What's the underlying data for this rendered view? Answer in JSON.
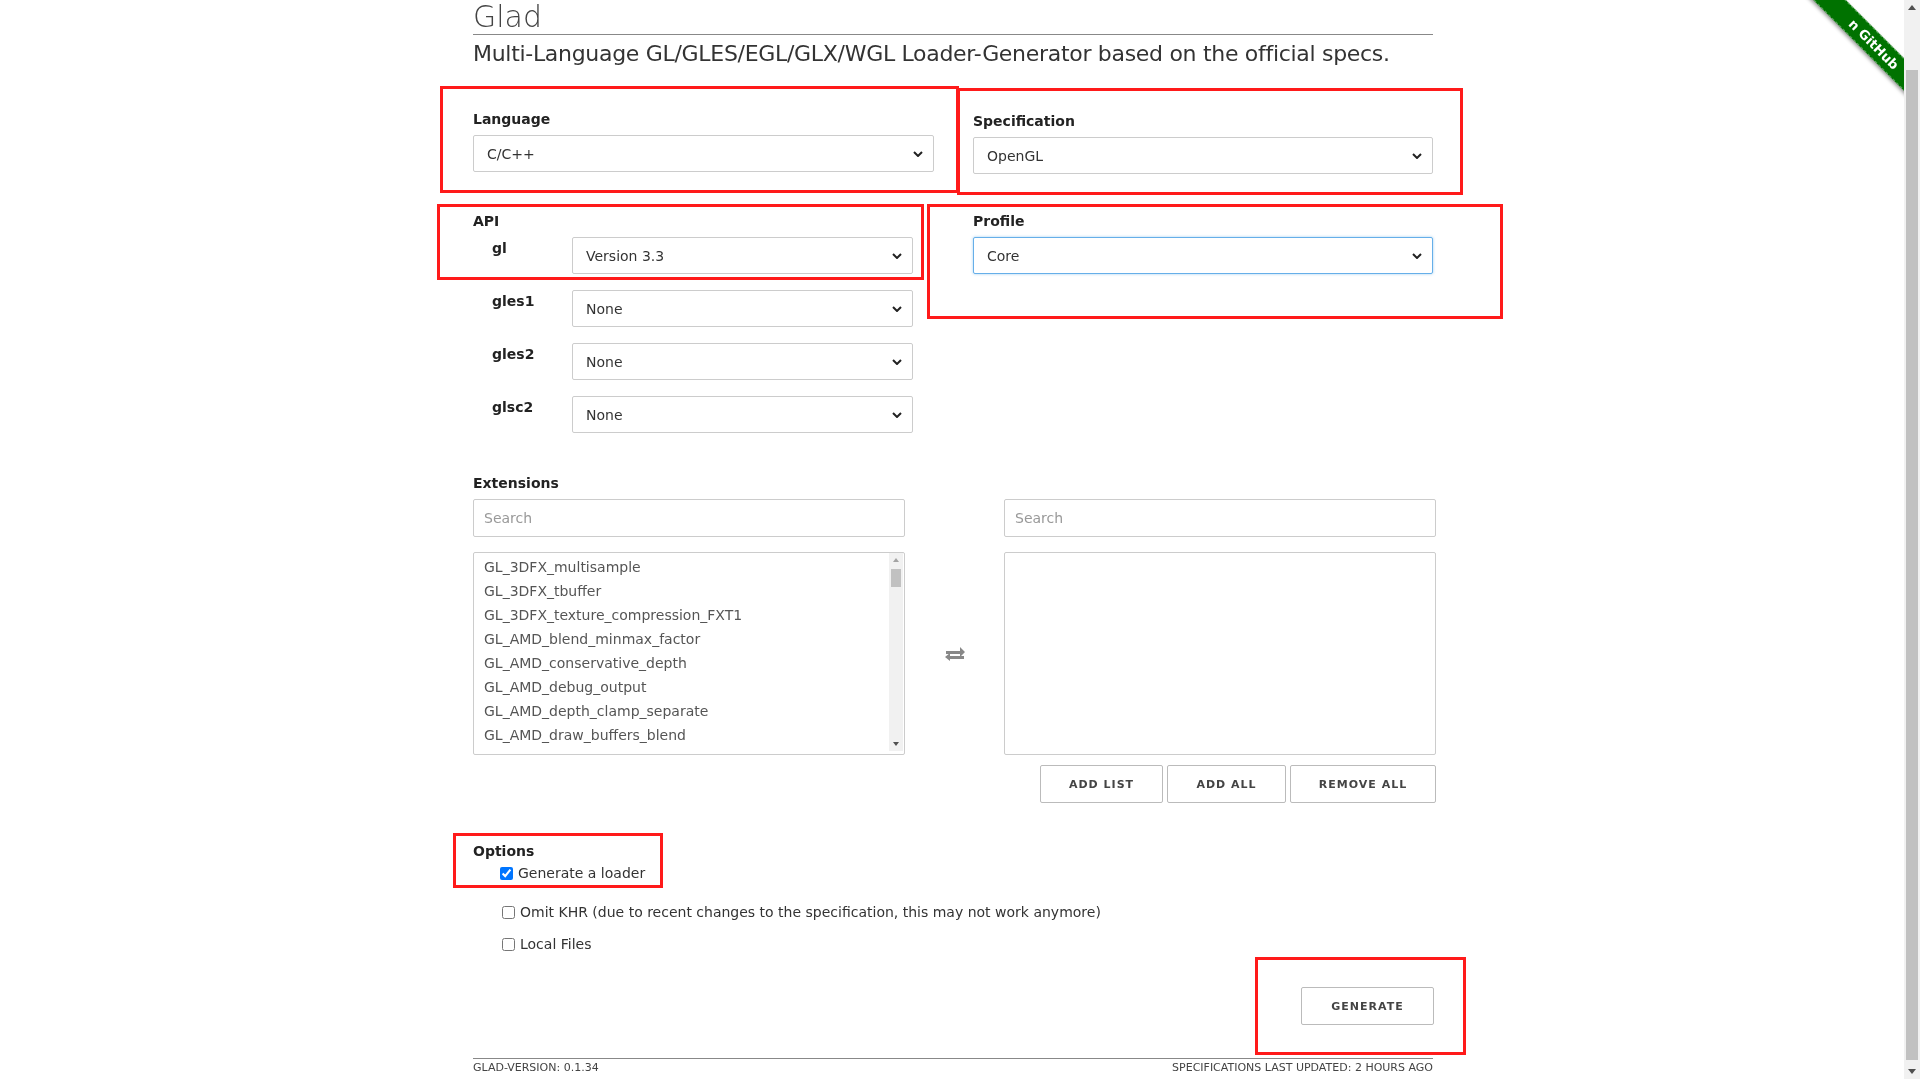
{
  "title": "Glad",
  "subtitle": "Multi-Language GL/GLES/EGL/GLX/WGL Loader-Generator based on the official specs.",
  "language": {
    "label": "Language",
    "value": "C/C++",
    "highlighted": true
  },
  "specification": {
    "label": "Specification",
    "value": "OpenGL",
    "highlighted": true
  },
  "api": {
    "label": "API",
    "highlighted": true,
    "rows": [
      {
        "name": "gl",
        "value": "Version 3.3"
      },
      {
        "name": "gles1",
        "value": "None"
      },
      {
        "name": "gles2",
        "value": "None"
      },
      {
        "name": "glsc2",
        "value": "None"
      }
    ]
  },
  "profile": {
    "label": "Profile",
    "value": "Core",
    "focused": true,
    "highlighted": true
  },
  "extensions": {
    "label": "Extensions",
    "search_left": {
      "placeholder": "Search"
    },
    "search_right": {
      "placeholder": "Search"
    },
    "available": [
      "GL_3DFX_multisample",
      "GL_3DFX_tbuffer",
      "GL_3DFX_texture_compression_FXT1",
      "GL_AMD_blend_minmax_factor",
      "GL_AMD_conservative_depth",
      "GL_AMD_debug_output",
      "GL_AMD_depth_clamp_separate",
      "GL_AMD_draw_buffers_blend"
    ],
    "buttons": [
      "ADD LIST",
      "ADD ALL",
      "REMOVE ALL"
    ]
  },
  "options": {
    "label": "Options",
    "highlighted": true,
    "items": [
      {
        "label": "Generate a loader",
        "checked": true
      },
      {
        "label": "Omit KHR (due to recent changes to the specification, this may not work anymore)",
        "checked": false
      },
      {
        "label": "Local Files",
        "checked": false
      }
    ]
  },
  "generate": {
    "label": "GENERATE",
    "highlighted": true
  },
  "footer": {
    "version": "GLAD-VERSION: 0.1.34",
    "updated": "SPECIFICATIONS LAST UPDATED: 2 HOURS AGO"
  },
  "ribbon": {
    "label": "n GitHub"
  }
}
